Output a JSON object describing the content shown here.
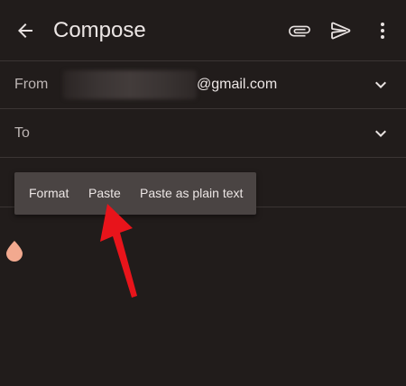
{
  "header": {
    "title": "Compose"
  },
  "from_row": {
    "label": "From",
    "email_domain": "@gmail.com"
  },
  "to_row": {
    "label": "To"
  },
  "context_menu": {
    "items": [
      {
        "label": "Format"
      },
      {
        "label": "Paste"
      },
      {
        "label": "Paste as plain text"
      }
    ]
  },
  "icons": {
    "back": "arrow-left-icon",
    "attach": "paperclip-icon",
    "send": "send-icon",
    "more": "more-vert-icon",
    "expand": "chevron-down-icon"
  },
  "colors": {
    "background": "#211c1b",
    "menu": "#4a4443",
    "cursor_handle": "#f2a98f",
    "annotation_arrow": "#e8141b"
  }
}
